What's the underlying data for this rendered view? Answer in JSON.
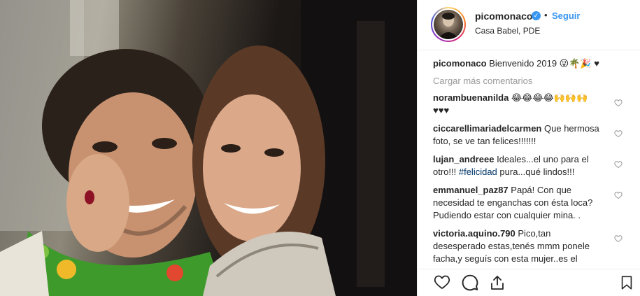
{
  "post": {
    "username": "picomonaco",
    "follow_label": "Seguir",
    "separator": "•",
    "location": "Casa Babel, PDE",
    "caption": {
      "username": "picomonaco",
      "text": "Bienvenido 2019 😜🌴🎉 ♥"
    },
    "load_more_label": "Cargar más comentarios"
  },
  "comments": [
    {
      "username": "norambuenanilda",
      "text": "😂😂😂😂🙌🙌🙌♥♥♥"
    },
    {
      "username": "ciccarellimariadelcarmen",
      "text": "Que hermosa foto, se ve tan felices!!!!!!!"
    },
    {
      "username": "lujan_andreee",
      "text": "Ideales...el uno para el otro!!! ",
      "hashtag": "#felicidad",
      "text_after": " pura...qué lindos!!!"
    },
    {
      "username": "emmanuel_paz87",
      "text": "Papá! Con que necesidad te enganchas con ésta loca? Pudiendo estar con cualquier mina. ."
    },
    {
      "username": "victoria.aquino.790",
      "text": "Pico,tan desesperado estas,tenés mmm ponele facha,y seguís con esta mujer..es el"
    }
  ],
  "icons": {
    "verified": "verified-badge-icon",
    "like": "heart-outline-icon",
    "comment": "comment-bubble-icon",
    "share": "share-upload-icon",
    "save": "bookmark-icon"
  },
  "colors": {
    "link_blue": "#3897f0",
    "hashtag": "#003569",
    "muted": "#999999",
    "text": "#262626"
  }
}
